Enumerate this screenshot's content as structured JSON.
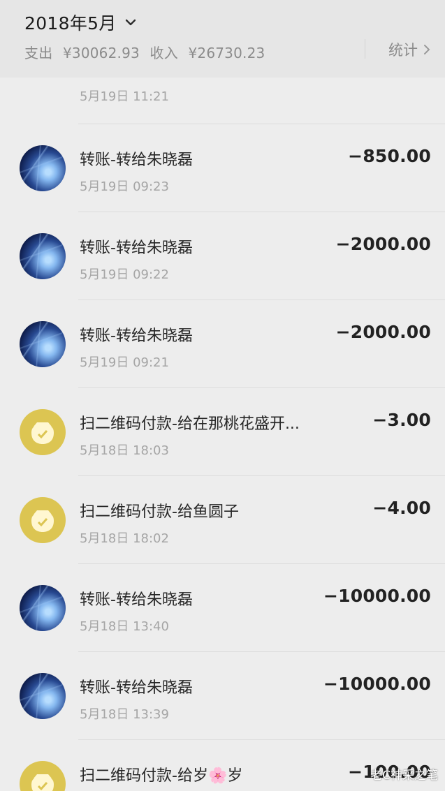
{
  "header": {
    "month": "2018年5月",
    "expense_label": "支出",
    "expense_value": "¥30062.93",
    "income_label": "收入",
    "income_value": "¥26730.23",
    "stats_label": "统计"
  },
  "transactions": [
    {
      "title": "",
      "time": "5月19日 11:21",
      "amount": "",
      "icon": "gold-money-bag-icon"
    },
    {
      "title": "转账-转给朱晓磊",
      "time": "5月19日 09:23",
      "amount": "−850.00",
      "icon": "space-avatar-icon"
    },
    {
      "title": "转账-转给朱晓磊",
      "time": "5月19日 09:22",
      "amount": "−2000.00",
      "icon": "space-avatar-icon"
    },
    {
      "title": "转账-转给朱晓磊",
      "time": "5月19日 09:21",
      "amount": "−2000.00",
      "icon": "space-avatar-icon"
    },
    {
      "title": "扫二维码付款-给在那桃花盛开...",
      "time": "5月18日 18:03",
      "amount": "−3.00",
      "icon": "gold-money-bag-icon"
    },
    {
      "title": "扫二维码付款-给鱼圆子",
      "time": "5月18日 18:02",
      "amount": "−4.00",
      "icon": "gold-money-bag-icon"
    },
    {
      "title": "转账-转给朱晓磊",
      "time": "5月18日 13:40",
      "amount": "−10000.00",
      "icon": "space-avatar-icon"
    },
    {
      "title": "转账-转给朱晓磊",
      "time": "5月18日 13:39",
      "amount": "−10000.00",
      "icon": "space-avatar-icon"
    },
    {
      "title": "扫二维码付款-给岁🌸岁",
      "time": "",
      "amount": "−100.00",
      "icon": "gold-money-bag-icon"
    }
  ],
  "watermark": "老C神采之笔"
}
